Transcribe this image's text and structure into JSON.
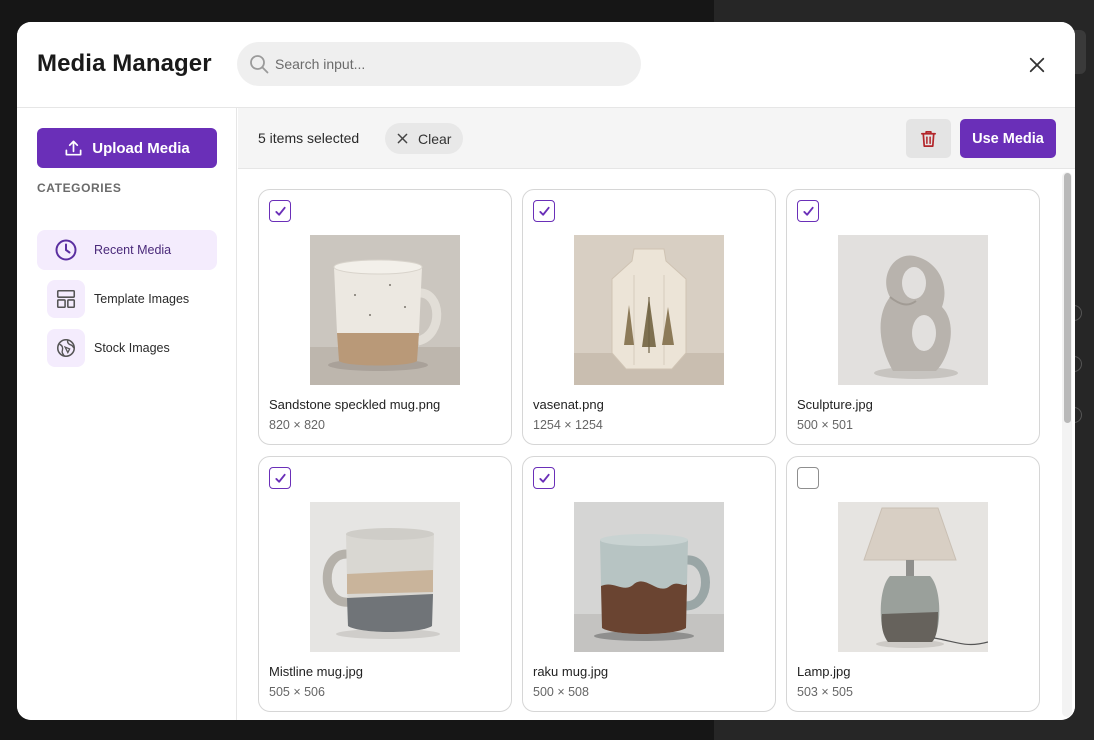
{
  "modal": {
    "title": "Media Manager",
    "search_placeholder": "Search input...",
    "close_icon": "close-icon"
  },
  "sidebar": {
    "upload_label": "Upload Media",
    "categories_heading": "CATEGORIES",
    "items": [
      {
        "label": "Recent Media",
        "icon": "clock-icon",
        "active": true
      },
      {
        "label": "Template Images",
        "icon": "layout-icon",
        "active": false
      },
      {
        "label": "Stock Images",
        "icon": "globe-icon",
        "active": false
      }
    ]
  },
  "toolbar": {
    "selected_text": "5 items selected",
    "clear_label": "Clear",
    "use_label": "Use Media",
    "trash_icon": "trash-icon"
  },
  "media": [
    {
      "name": "Sandstone speckled mug.png",
      "dims": "820 × 820",
      "selected": true
    },
    {
      "name": "vasenat.png",
      "dims": "1254 × 1254",
      "selected": true
    },
    {
      "name": "Sculpture.jpg",
      "dims": "500 × 501",
      "selected": true
    },
    {
      "name": "Mistline mug.jpg",
      "dims": "505 × 506",
      "selected": true
    },
    {
      "name": "raku mug.jpg",
      "dims": "500 × 508",
      "selected": true
    },
    {
      "name": "Lamp.jpg",
      "dims": "503 × 505",
      "selected": false
    }
  ],
  "colors": {
    "accent": "#6a2fb8",
    "accent_soft": "#f4ecfd",
    "danger": "#b3262b"
  }
}
